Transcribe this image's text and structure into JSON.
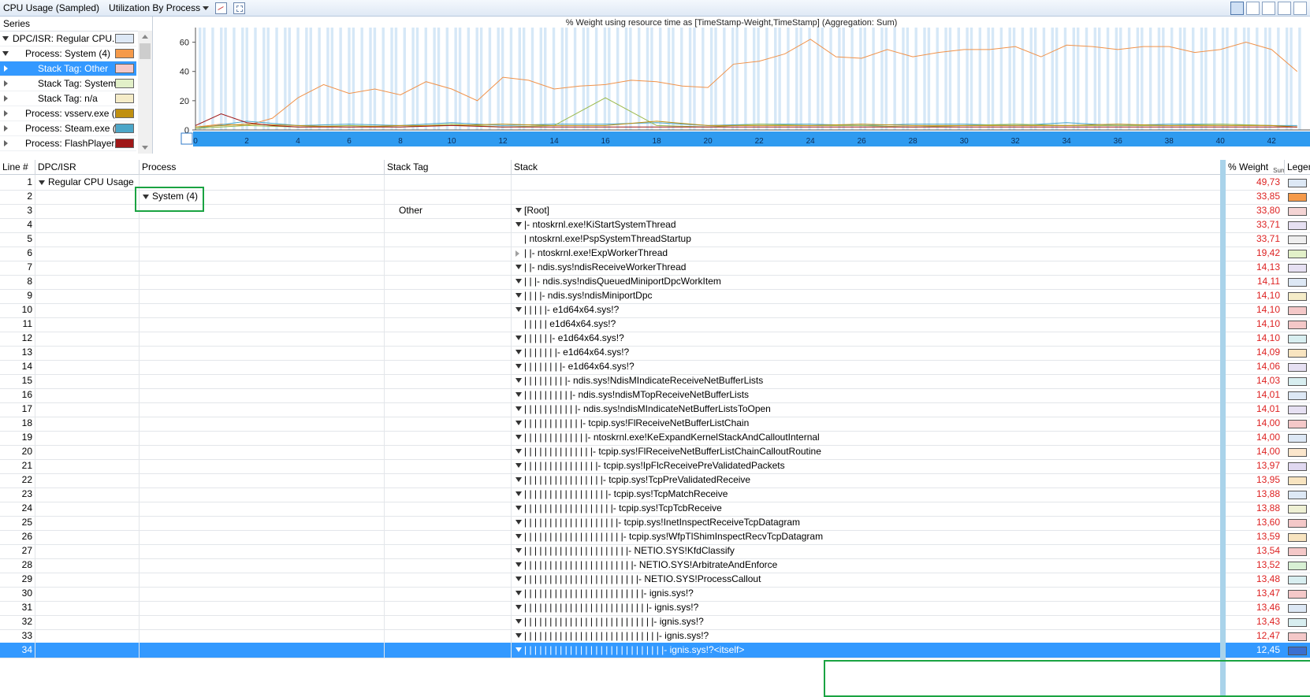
{
  "window": {
    "title": "CPU Usage (Sampled)",
    "view_selector": "Utilization By Process"
  },
  "series": {
    "header": "Series",
    "items": [
      {
        "label": "DPC/ISR: Regular CPU...",
        "color": "#dde8f5",
        "expander": "down",
        "indent": 0,
        "selected": false
      },
      {
        "label": "Process: System (4)",
        "color": "#f59a4a",
        "expander": "down",
        "indent": 1,
        "selected": false
      },
      {
        "label": "Stack Tag: Other",
        "color": "#f4c8c8",
        "expander": "right",
        "indent": 2,
        "selected": true
      },
      {
        "label": "Stack Tag: System",
        "color": "#e2f0c8",
        "expander": "right",
        "indent": 2,
        "selected": false
      },
      {
        "label": "Stack Tag: n/a",
        "color": "#f5ecc8",
        "expander": "right",
        "indent": 2,
        "selected": false
      },
      {
        "label": "Process: vsserv.exe (...",
        "color": "#c09010",
        "expander": "right",
        "indent": 1,
        "selected": false
      },
      {
        "label": "Process: Steam.exe (...",
        "color": "#4ba6c8",
        "expander": "right",
        "indent": 1,
        "selected": false
      },
      {
        "label": "Process: FlashPlayer...",
        "color": "#a01818",
        "expander": "right",
        "indent": 1,
        "selected": false
      }
    ]
  },
  "chart_data": {
    "type": "line",
    "title": "% Weight using resource time as [TimeStamp-Weight,TimeStamp] (Aggregation: Sum)",
    "xlabel": "",
    "ylabel": "",
    "ylim": [
      0,
      70
    ],
    "xlim": [
      0,
      43.5
    ],
    "yticks": [
      "0",
      "20",
      "40",
      "60"
    ],
    "xticks": [
      "0",
      "2",
      "4",
      "6",
      "8",
      "10",
      "12",
      "14",
      "16",
      "18",
      "20",
      "22",
      "24",
      "26",
      "28",
      "30",
      "32",
      "34",
      "36",
      "38",
      "40",
      "42"
    ],
    "series": [
      {
        "color": "#f0924a",
        "x": [
          0,
          1,
          2,
          3,
          4,
          5,
          6,
          7,
          8,
          9,
          10,
          11,
          12,
          13,
          14,
          15,
          16,
          17,
          18,
          19,
          20,
          21,
          22,
          23,
          24,
          25,
          26,
          27,
          28,
          29,
          30,
          31,
          32,
          33,
          34,
          35,
          36,
          37,
          38,
          39,
          40,
          41,
          42,
          43
        ],
        "values": [
          2,
          4,
          3,
          8,
          22,
          31,
          25,
          28,
          24,
          33,
          28,
          20,
          36,
          34,
          28,
          30,
          31,
          34,
          33,
          30,
          29,
          45,
          47,
          52,
          62,
          50,
          49,
          55,
          50,
          53,
          55,
          55,
          57,
          50,
          58,
          57,
          55,
          57,
          57,
          53,
          55,
          60,
          55,
          40
        ]
      },
      {
        "color": "#4ba6c8",
        "x": [
          0,
          2,
          4,
          6,
          8,
          10,
          12,
          14,
          16,
          18,
          20,
          22,
          24,
          26,
          28,
          30,
          32,
          34,
          36,
          38,
          40,
          42,
          43
        ],
        "values": [
          1,
          6,
          3,
          4,
          3,
          5,
          3,
          4,
          4,
          5,
          3,
          4,
          4,
          3,
          4,
          4,
          3,
          5,
          3,
          4,
          4,
          3,
          3
        ]
      },
      {
        "color": "#9ab84a",
        "x": [
          0,
          2,
          4,
          6,
          8,
          10,
          12,
          14,
          16,
          18,
          20,
          22,
          24,
          26,
          28,
          30,
          32,
          34,
          36,
          38,
          40,
          42,
          43
        ],
        "values": [
          1,
          3,
          2,
          3,
          2,
          4,
          2,
          3,
          22,
          3,
          2,
          4,
          3,
          3,
          2,
          3,
          4,
          3,
          3,
          3,
          4,
          3,
          2
        ]
      },
      {
        "color": "#c09010",
        "x": [
          0,
          2,
          4,
          6,
          8,
          10,
          12,
          14,
          16,
          18,
          20,
          22,
          24,
          26,
          28,
          30,
          32,
          34,
          36,
          38,
          40,
          42,
          43
        ],
        "values": [
          2,
          4,
          3,
          2,
          3,
          3,
          4,
          3,
          3,
          6,
          3,
          3,
          3,
          4,
          3,
          3,
          3,
          3,
          4,
          3,
          3,
          3,
          2
        ]
      },
      {
        "color": "#a01818",
        "x": [
          0,
          1,
          2,
          3,
          4,
          6,
          8,
          10,
          12,
          14,
          16,
          18,
          20,
          22,
          24,
          26,
          28,
          30,
          32,
          34,
          36,
          38,
          40,
          42,
          43
        ],
        "values": [
          3,
          11,
          5,
          3,
          2,
          2,
          2,
          3,
          2,
          2,
          2,
          2,
          2,
          2,
          2,
          2,
          2,
          2,
          2,
          2,
          2,
          2,
          2,
          2,
          2
        ]
      }
    ]
  },
  "grid": {
    "columns": [
      "Line #",
      "DPC/ISR",
      "Process",
      "Stack Tag",
      "Stack",
      "% Weight",
      "Legend"
    ],
    "sort_sub": "Sum",
    "rows": [
      {
        "line": "1",
        "dpc": "Regular CPU Usage",
        "process": "",
        "tag": "",
        "depth": -1,
        "stack": "",
        "expander": "",
        "weight": "49,73",
        "legend": "#dde8f5"
      },
      {
        "line": "2",
        "dpc": "",
        "process": "System (4)",
        "tag": "",
        "depth": -1,
        "stack": "",
        "expander": "",
        "weight": "33,85",
        "legend": "#f59a4a"
      },
      {
        "line": "3",
        "dpc": "",
        "process": "",
        "tag": "Other",
        "depth": 0,
        "stack": "[Root]",
        "expander": "down",
        "weight": "33,80",
        "legend": "#f4d4d4"
      },
      {
        "line": "4",
        "dpc": "",
        "process": "",
        "tag": "",
        "depth": 1,
        "stack": "|- ntoskrnl.exe!KiStartSystemThread",
        "expander": "down",
        "weight": "33,71",
        "legend": "#e6e0f2"
      },
      {
        "line": "5",
        "dpc": "",
        "process": "",
        "tag": "",
        "depth": 1,
        "stack": "|  ntoskrnl.exe!PspSystemThreadStartup",
        "expander": "",
        "weight": "33,71",
        "legend": "#eeeeee"
      },
      {
        "line": "6",
        "dpc": "",
        "process": "",
        "tag": "",
        "depth": 1,
        "stack": "|  |- ntoskrnl.exe!ExpWorkerThread",
        "expander": "right",
        "weight": "19,42",
        "legend": "#e2f0c8"
      },
      {
        "line": "7",
        "dpc": "",
        "process": "",
        "tag": "",
        "depth": 1,
        "stack": "|  |- ndis.sys!ndisReceiveWorkerThread",
        "expander": "down",
        "weight": "14,13",
        "legend": "#e6e0f2"
      },
      {
        "line": "8",
        "dpc": "",
        "process": "",
        "tag": "",
        "depth": 2,
        "stack": "|  |  |- ndis.sys!ndisQueuedMiniportDpcWorkItem",
        "expander": "down",
        "weight": "14,11",
        "legend": "#dde8f5"
      },
      {
        "line": "9",
        "dpc": "",
        "process": "",
        "tag": "",
        "depth": 3,
        "stack": "|  |  |  |- ndis.sys!ndisMiniportDpc",
        "expander": "down",
        "weight": "14,10",
        "legend": "#f5ecc8"
      },
      {
        "line": "10",
        "dpc": "",
        "process": "",
        "tag": "",
        "depth": 4,
        "stack": "|  |  |  |  |- e1d64x64.sys!?",
        "expander": "down",
        "weight": "14,10",
        "legend": "#f4c8c8"
      },
      {
        "line": "11",
        "dpc": "",
        "process": "",
        "tag": "",
        "depth": 4,
        "stack": "|  |  |  |  |  e1d64x64.sys!?",
        "expander": "",
        "weight": "14,10",
        "legend": "#f4c8c8"
      },
      {
        "line": "12",
        "dpc": "",
        "process": "",
        "tag": "",
        "depth": 5,
        "stack": "|  |  |  |  |  |- e1d64x64.sys!?",
        "expander": "down",
        "weight": "14,10",
        "legend": "#d8eef0"
      },
      {
        "line": "13",
        "dpc": "",
        "process": "",
        "tag": "",
        "depth": 6,
        "stack": "|  |  |  |  |  |  |- e1d64x64.sys!?",
        "expander": "down",
        "weight": "14,09",
        "legend": "#f8e4c0"
      },
      {
        "line": "14",
        "dpc": "",
        "process": "",
        "tag": "",
        "depth": 7,
        "stack": "|  |  |  |  |  |  |  |- e1d64x64.sys!?",
        "expander": "down",
        "weight": "14,06",
        "legend": "#e6e0f2"
      },
      {
        "line": "15",
        "dpc": "",
        "process": "",
        "tag": "",
        "depth": 8,
        "stack": "|  |  |  |  |  |  |  |  |- ndis.sys!NdisMIndicateReceiveNetBufferLists",
        "expander": "down",
        "weight": "14,03",
        "legend": "#d8eef0"
      },
      {
        "line": "16",
        "dpc": "",
        "process": "",
        "tag": "",
        "depth": 9,
        "stack": "|  |  |  |  |  |  |  |  |  |- ndis.sys!ndisMTopReceiveNetBufferLists",
        "expander": "down",
        "weight": "14,01",
        "legend": "#dde8f5"
      },
      {
        "line": "17",
        "dpc": "",
        "process": "",
        "tag": "",
        "depth": 10,
        "stack": "|  |  |  |  |  |  |  |  |  |  |- ndis.sys!ndisMIndicateNetBufferListsToOpen",
        "expander": "down",
        "weight": "14,01",
        "legend": "#e6e0f2"
      },
      {
        "line": "18",
        "dpc": "",
        "process": "",
        "tag": "",
        "depth": 11,
        "stack": "|  |  |  |  |  |  |  |  |  |  |  |- tcpip.sys!FlReceiveNetBufferListChain",
        "expander": "down",
        "weight": "14,00",
        "legend": "#f4c8c8"
      },
      {
        "line": "19",
        "dpc": "",
        "process": "",
        "tag": "",
        "depth": 12,
        "stack": "|  |  |  |  |  |  |  |  |  |  |  |  |- ntoskrnl.exe!KeExpandKernelStackAndCalloutInternal",
        "expander": "down",
        "weight": "14,00",
        "legend": "#dde8f5"
      },
      {
        "line": "20",
        "dpc": "",
        "process": "",
        "tag": "",
        "depth": 13,
        "stack": "|  |  |  |  |  |  |  |  |  |  |  |  |  |- tcpip.sys!FlReceiveNetBufferListChainCalloutRoutine",
        "expander": "down",
        "weight": "14,00",
        "legend": "#fbe6cc"
      },
      {
        "line": "21",
        "dpc": "",
        "process": "",
        "tag": "",
        "depth": 14,
        "stack": "|  |  |  |  |  |  |  |  |  |  |  |  |  |  |- tcpip.sys!IpFlcReceivePreValidatedPackets",
        "expander": "down",
        "weight": "13,97",
        "legend": "#e0d8f0"
      },
      {
        "line": "22",
        "dpc": "",
        "process": "",
        "tag": "",
        "depth": 15,
        "stack": "|  |  |  |  |  |  |  |  |  |  |  |  |  |  |  |- tcpip.sys!TcpPreValidatedReceive",
        "expander": "down",
        "weight": "13,95",
        "legend": "#f8e4c0"
      },
      {
        "line": "23",
        "dpc": "",
        "process": "",
        "tag": "",
        "depth": 16,
        "stack": "|  |  |  |  |  |  |  |  |  |  |  |  |  |  |  |  |- tcpip.sys!TcpMatchReceive",
        "expander": "down",
        "weight": "13,88",
        "legend": "#dde8f5"
      },
      {
        "line": "24",
        "dpc": "",
        "process": "",
        "tag": "",
        "depth": 17,
        "stack": "|  |  |  |  |  |  |  |  |  |  |  |  |  |  |  |  |  |- tcpip.sys!TcpTcbReceive",
        "expander": "down",
        "weight": "13,88",
        "legend": "#eef0d4"
      },
      {
        "line": "25",
        "dpc": "",
        "process": "",
        "tag": "",
        "depth": 18,
        "stack": "|  |  |  |  |  |  |  |  |  |  |  |  |  |  |  |  |  |  |- tcpip.sys!InetInspectReceiveTcpDatagram",
        "expander": "down",
        "weight": "13,60",
        "legend": "#f4c8c8"
      },
      {
        "line": "26",
        "dpc": "",
        "process": "",
        "tag": "",
        "depth": 19,
        "stack": "|  |  |  |  |  |  |  |  |  |  |  |  |  |  |  |  |  |  |  |- tcpip.sys!WfpTlShimInspectRecvTcpDatagram",
        "expander": "down",
        "weight": "13,59",
        "legend": "#f8e4c0"
      },
      {
        "line": "27",
        "dpc": "",
        "process": "",
        "tag": "",
        "depth": 20,
        "stack": "|  |  |  |  |  |  |  |  |  |  |  |  |  |  |  |  |  |  |  |  |- NETIO.SYS!KfdClassify",
        "expander": "down",
        "weight": "13,54",
        "legend": "#f4c8c8"
      },
      {
        "line": "28",
        "dpc": "",
        "process": "",
        "tag": "",
        "depth": 21,
        "stack": "|  |  |  |  |  |  |  |  |  |  |  |  |  |  |  |  |  |  |  |  |  |- NETIO.SYS!ArbitrateAndEnforce",
        "expander": "down",
        "weight": "13,52",
        "legend": "#d8f0d4"
      },
      {
        "line": "29",
        "dpc": "",
        "process": "",
        "tag": "",
        "depth": 22,
        "stack": "|  |  |  |  |  |  |  |  |  |  |  |  |  |  |  |  |  |  |  |  |  |  |- NETIO.SYS!ProcessCallout",
        "expander": "down",
        "weight": "13,48",
        "legend": "#d8eef0"
      },
      {
        "line": "30",
        "dpc": "",
        "process": "",
        "tag": "",
        "depth": 23,
        "stack": "|  |  |  |  |  |  |  |  |  |  |  |  |  |  |  |  |  |  |  |  |  |  |  |- ignis.sys!?",
        "expander": "down",
        "weight": "13,47",
        "legend": "#f4c8c8"
      },
      {
        "line": "31",
        "dpc": "",
        "process": "",
        "tag": "",
        "depth": 24,
        "stack": "|  |  |  |  |  |  |  |  |  |  |  |  |  |  |  |  |  |  |  |  |  |  |  |  |- ignis.sys!?",
        "expander": "down",
        "weight": "13,46",
        "legend": "#dde8f5"
      },
      {
        "line": "32",
        "dpc": "",
        "process": "",
        "tag": "",
        "depth": 25,
        "stack": "|  |  |  |  |  |  |  |  |  |  |  |  |  |  |  |  |  |  |  |  |  |  |  |  |  |- ignis.sys!?",
        "expander": "down",
        "weight": "13,43",
        "legend": "#d8eef0"
      },
      {
        "line": "33",
        "dpc": "",
        "process": "",
        "tag": "",
        "depth": 26,
        "stack": "|  |  |  |  |  |  |  |  |  |  |  |  |  |  |  |  |  |  |  |  |  |  |  |  |  |  |- ignis.sys!?",
        "expander": "down",
        "weight": "12,47",
        "legend": "#f4c8c8"
      },
      {
        "line": "34",
        "dpc": "",
        "process": "",
        "tag": "",
        "depth": 27,
        "stack": "|  |  |  |  |  |  |  |  |  |  |  |  |  |  |  |  |  |  |  |  |  |  |  |  |  |  |  |- ignis.sys!?<itself>",
        "expander": "down",
        "weight": "12,45",
        "legend": "#3a6fd0",
        "selected": true
      }
    ]
  }
}
